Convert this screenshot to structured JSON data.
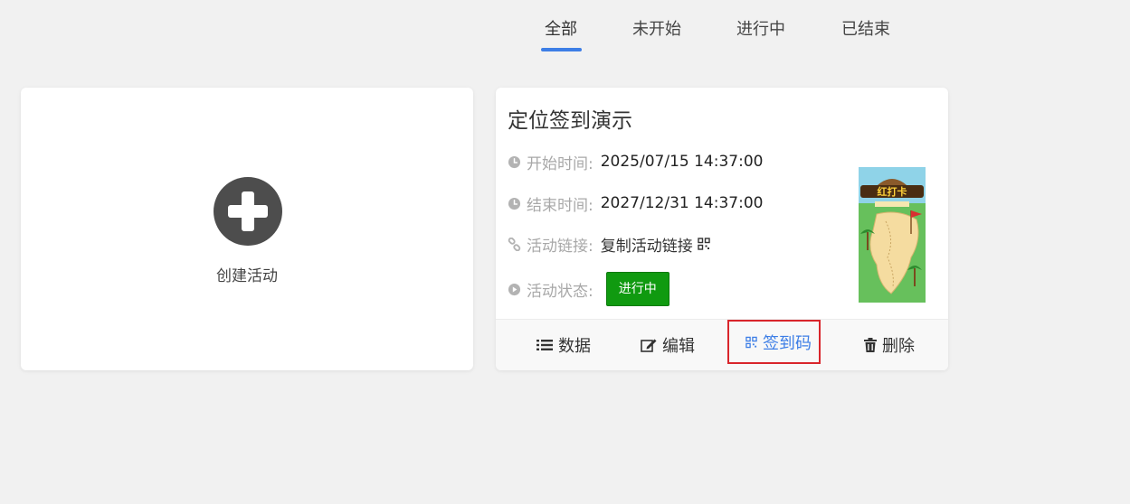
{
  "tabs": [
    {
      "label": "全部",
      "active": true
    },
    {
      "label": "未开始",
      "active": false
    },
    {
      "label": "进行中",
      "active": false
    },
    {
      "label": "已结束",
      "active": false
    }
  ],
  "accent_color": "#3d7ee6",
  "create_card": {
    "label": "创建活动",
    "icon": "plus-circle-icon"
  },
  "activity": {
    "title": "定位签到演示",
    "start_label": "开始时间:",
    "start_value": "2025/07/15 14:37:00",
    "end_label": "结束时间:",
    "end_value": "2027/12/31 14:37:00",
    "link_label": "活动链接:",
    "link_value": "复制活动链接",
    "status_label": "活动状态:",
    "status_value": "进行中",
    "status_color": "#109a10",
    "thumbnail": {
      "banner_text": "红打卡",
      "icon": "map-poster-thumbnail"
    },
    "actions": [
      {
        "label": "数据",
        "icon": "list-icon"
      },
      {
        "label": "编辑",
        "icon": "edit-icon"
      },
      {
        "label": "签到码",
        "icon": "qrcode-icon",
        "highlighted": true
      },
      {
        "label": "删除",
        "icon": "trash-icon"
      }
    ],
    "highlight_color": "#d9252b"
  }
}
